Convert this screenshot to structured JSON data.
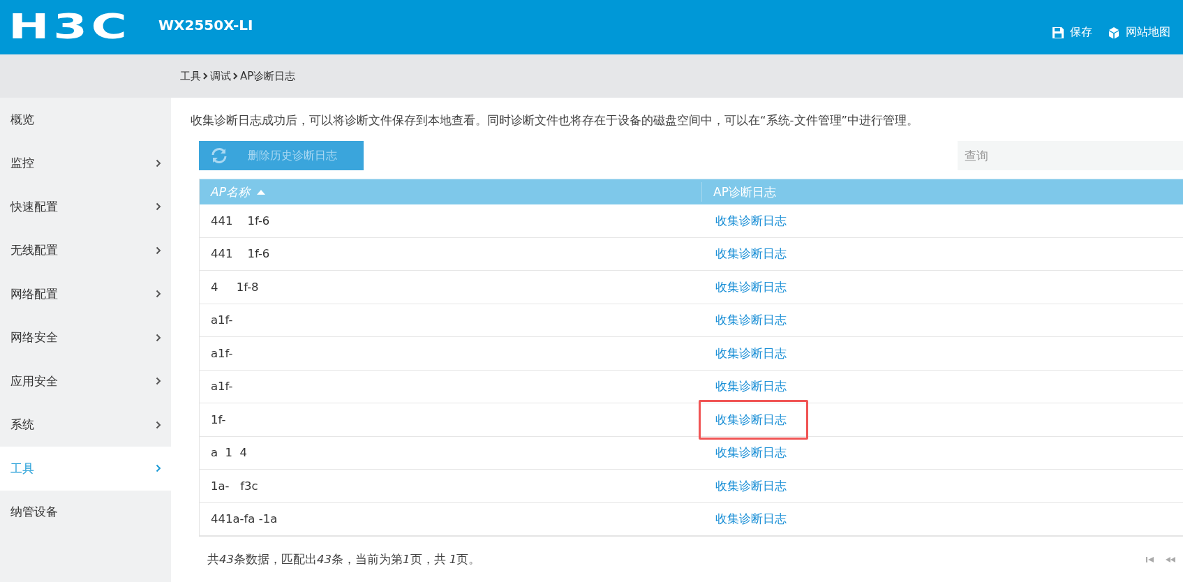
{
  "header": {
    "logo": "H3C",
    "model": "WX2550X-LI",
    "actions": [
      {
        "kind": "save",
        "label": "保存"
      },
      {
        "kind": "sitemap",
        "label": "网站地图"
      }
    ]
  },
  "breadcrumb": [
    "工具",
    "调试",
    "AP诊断日志"
  ],
  "sidebar": {
    "items": [
      {
        "label": "概览",
        "has_children": false,
        "selected": false
      },
      {
        "label": "监控",
        "has_children": true,
        "selected": false
      },
      {
        "label": "快速配置",
        "has_children": true,
        "selected": false
      },
      {
        "label": "无线配置",
        "has_children": true,
        "selected": false
      },
      {
        "label": "网络配置",
        "has_children": true,
        "selected": false
      },
      {
        "label": "网络安全",
        "has_children": true,
        "selected": false
      },
      {
        "label": "应用安全",
        "has_children": true,
        "selected": false
      },
      {
        "label": "系统",
        "has_children": true,
        "selected": false
      },
      {
        "label": "工具",
        "has_children": true,
        "selected": true
      },
      {
        "label": "纳管设备",
        "has_children": false,
        "selected": false
      }
    ]
  },
  "description": "收集诊断日志成功后，可以将诊断文件保存到本地查看。同时诊断文件也将存在于设备的磁盘空间中，可以在“系统-文件管理”中进行管理。",
  "toolbar": {
    "delete_button": {
      "label": "删除历史诊断日志",
      "disabled": true
    },
    "search": {
      "placeholder": "查询"
    }
  },
  "table": {
    "columns": [
      {
        "label": "AP名称",
        "sorted": true
      },
      {
        "label": "AP诊断日志",
        "sorted": false
      }
    ],
    "rows": [
      {
        "ap_name": "441    1f-6",
        "action": "收集诊断日志",
        "highlighted": false
      },
      {
        "ap_name": "441    1f-6",
        "action": "收集诊断日志",
        "highlighted": false
      },
      {
        "ap_name": "4     1f-8",
        "action": "收集诊断日志",
        "highlighted": false
      },
      {
        "ap_name": "a1f-",
        "action": "收集诊断日志",
        "highlighted": false
      },
      {
        "ap_name": "a1f-",
        "action": "收集诊断日志",
        "highlighted": false
      },
      {
        "ap_name": "a1f-",
        "action": "收集诊断日志",
        "highlighted": false
      },
      {
        "ap_name": "1f-",
        "action": "收集诊断日志",
        "highlighted": true
      },
      {
        "ap_name": "a  1  4",
        "action": "收集诊断日志",
        "highlighted": false
      },
      {
        "ap_name": "1a-   f3c",
        "action": "收集诊断日志",
        "highlighted": false
      },
      {
        "ap_name": "441a-fa -1a",
        "action": "收集诊断日志",
        "highlighted": false
      }
    ]
  },
  "footer": {
    "summary": [
      {
        "text": "共",
        "italic": false
      },
      {
        "text": "43",
        "italic": true
      },
      {
        "text": "条数据，匹配出",
        "italic": false
      },
      {
        "text": "43",
        "italic": true
      },
      {
        "text": "条，当前为第",
        "italic": false
      },
      {
        "text": "1",
        "italic": true
      },
      {
        "text": "页，共 ",
        "italic": false
      },
      {
        "text": "1",
        "italic": true
      },
      {
        "text": "页。",
        "italic": false
      }
    ]
  }
}
